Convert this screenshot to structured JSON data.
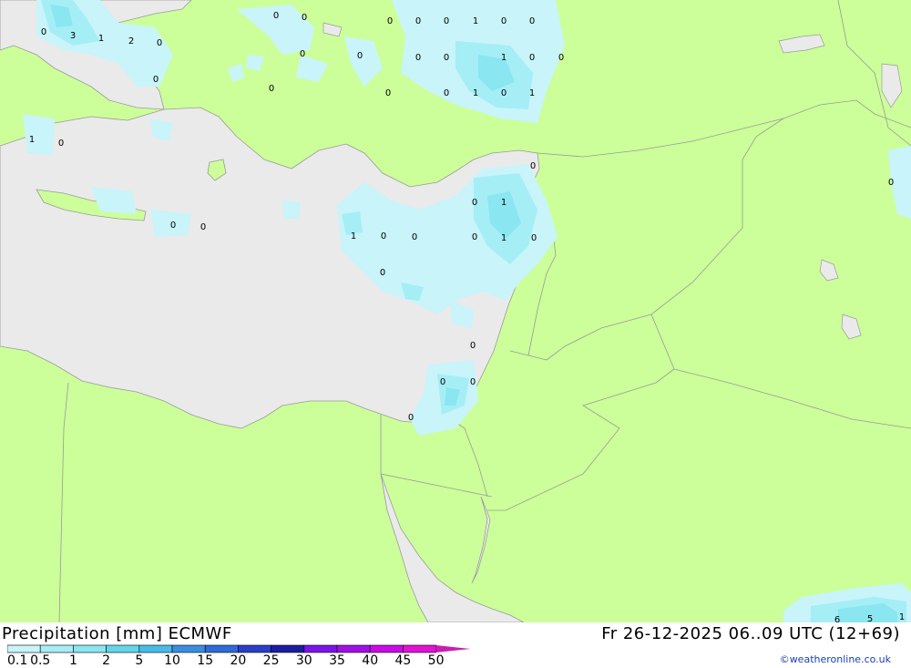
{
  "header": {
    "title": "Precipitation [mm] ECMWF",
    "valid_time": "Fr 26-12-2025 06..09 UTC (12+69)",
    "credit": "©weatheronline.co.uk"
  },
  "legend": {
    "levels": [
      "0.1",
      "0.5",
      "1",
      "2",
      "5",
      "10",
      "15",
      "20",
      "25",
      "30",
      "35",
      "40",
      "45",
      "50"
    ],
    "colors": [
      "#c8f4fa",
      "#a5eef6",
      "#8ae6f0",
      "#62d6ea",
      "#46bce8",
      "#3a8ee0",
      "#2e6ad8",
      "#2a3ec8",
      "#1c1ca0",
      "#7a14e8",
      "#a010e6",
      "#c80ce6",
      "#e012d4",
      "#c81eb4"
    ]
  },
  "map": {
    "land_color": "#ccff99",
    "sea_color": "#eaeaea",
    "border_color": "#9a9a9a",
    "value_labels": [
      {
        "text": "0"
      },
      {
        "text": "3"
      },
      {
        "text": "1"
      },
      {
        "text": "2"
      },
      {
        "text": "0"
      },
      {
        "text": "0"
      },
      {
        "text": "0"
      },
      {
        "text": "0"
      },
      {
        "text": "0"
      },
      {
        "text": "0"
      },
      {
        "text": "1"
      },
      {
        "text": "0"
      },
      {
        "text": "0"
      },
      {
        "text": "0"
      },
      {
        "text": "0"
      },
      {
        "text": "0"
      },
      {
        "text": "0"
      },
      {
        "text": "1"
      },
      {
        "text": "0"
      },
      {
        "text": "0"
      },
      {
        "text": "0"
      },
      {
        "text": "0"
      },
      {
        "text": "0"
      },
      {
        "text": "1"
      },
      {
        "text": "0"
      },
      {
        "text": "1"
      },
      {
        "text": "1"
      },
      {
        "text": "0"
      },
      {
        "text": "0"
      },
      {
        "text": "0"
      },
      {
        "text": "0"
      },
      {
        "text": "0"
      },
      {
        "text": "1"
      },
      {
        "text": "1"
      },
      {
        "text": "0"
      },
      {
        "text": "0"
      },
      {
        "text": "0"
      },
      {
        "text": "1"
      },
      {
        "text": "0"
      },
      {
        "text": "0"
      },
      {
        "text": "0"
      },
      {
        "text": "0"
      },
      {
        "text": "0"
      },
      {
        "text": "0"
      },
      {
        "text": "0"
      },
      {
        "text": "0"
      },
      {
        "text": "5"
      },
      {
        "text": "6"
      },
      {
        "text": "1"
      }
    ]
  }
}
